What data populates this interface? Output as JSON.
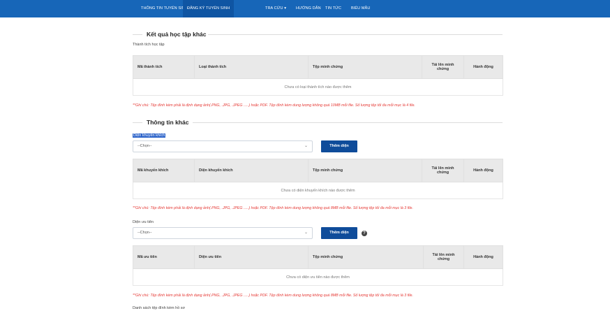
{
  "nav": {
    "items": [
      {
        "label": "THÔNG TIN TUYỂN SINH"
      },
      {
        "label": "ĐĂNG KÝ TUYỂN SINH"
      },
      {
        "label": "TRA CỨU ▾"
      },
      {
        "label": "HƯỚNG DẪN"
      },
      {
        "label": "TIN TỨC"
      },
      {
        "label": "BIỂU MẪU"
      }
    ],
    "active_index": 1,
    "background": "#1766b8"
  },
  "ket_qua": {
    "title": "Kết quả học tập khác",
    "sub_label": "Thành tích học tập",
    "columns": [
      "Mã thành tích",
      "Loại thành tích",
      "Tệp minh chứng",
      "Tải lên minh chứng",
      "Hành động"
    ],
    "empty_text": "Chưa có loại thành tích nào được thêm",
    "note": "**Ghi chú: Tệp đính kèm phải là định dạng ảnh(.PNG, .JPG, .JPEG .....) hoặc PDF. Tệp đính kèm dung lượng không quá 10MB mỗi file. Số lượng tệp tối đa mỗi mục là 4 file."
  },
  "thong_tin_khac": {
    "title": "Thông tin khác",
    "khuyen_khich": {
      "label": "Diện khuyến khích",
      "select_value": "--Chọn--",
      "button": "Thêm diện",
      "columns": [
        "Mã khuyến khích",
        "Diện khuyến khích",
        "Tệp minh chứng",
        "Tải lên minh chứng",
        "Hành động"
      ],
      "empty_text": "Chưa có diện khuyến khích nào được thêm",
      "note": "**Ghi chú: Tệp đính kèm phải là định dạng ảnh(.PNG, .JPG, .JPEG .....) hoặc PDF. Tệp đính kèm dung lượng không quá 8MB mỗi file. Số lượng tệp tối đa mỗi mục là 3 file."
    },
    "uu_tien": {
      "label": "Diện ưu tiên",
      "select_value": "--Chọn--",
      "button": "Thêm diện",
      "help": "?",
      "columns": [
        "Mã ưu tiên",
        "Diện ưu tiên",
        "Tệp minh chứng",
        "Tải lên minh chứng",
        "Hành động"
      ],
      "empty_text": "Chưa có diện ưu tiên nào được thêm",
      "note": "**Ghi chú: Tệp đính kèm phải là định dạng ảnh(.PNG, .JPG, .JPEG .....) hoặc PDF. Tệp đính kèm dung lượng không quá 8MB mỗi file. Số lượng tệp tối đa mỗi mục là 3 file."
    },
    "bottom_label": "Danh sách tệp đính kèm hồ sơ"
  },
  "colors": {
    "nav": "#1766b8",
    "button": "#0f4c9a",
    "note": "#e53935",
    "header_bg": "#e9e9e9"
  }
}
